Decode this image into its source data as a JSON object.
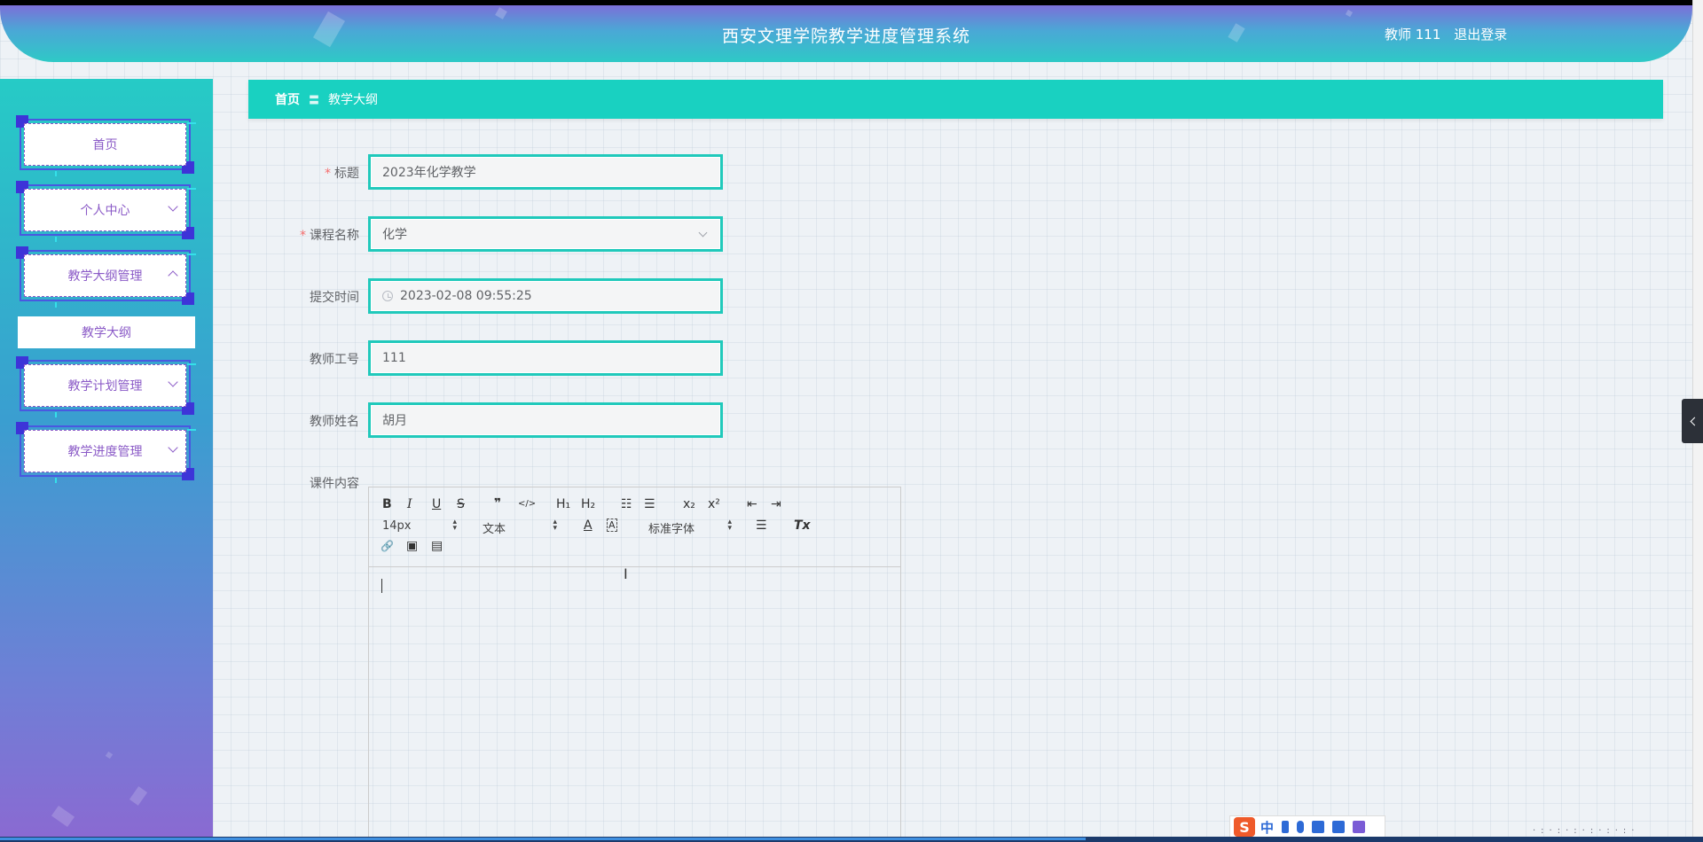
{
  "header": {
    "system_title": "西安文理学院教学进度管理系统",
    "user_label": "教师 111",
    "logout_label": "退出登录"
  },
  "sidebar": {
    "items": [
      {
        "label": "首页"
      },
      {
        "label": "个人中心"
      },
      {
        "label": "教学大纲管理"
      },
      {
        "label": "教学计划管理"
      },
      {
        "label": "教学进度管理"
      }
    ],
    "active_sub_item": "教学大纲"
  },
  "breadcrumb": {
    "home": "首页",
    "separator": "〓",
    "current": "教学大纲"
  },
  "form": {
    "title": {
      "label": "标题",
      "required": true,
      "value": "2023年化学教学"
    },
    "course": {
      "label": "课程名称",
      "required": true,
      "value": "化学"
    },
    "submit_time": {
      "label": "提交时间",
      "value": "2023-02-08 09:55:25"
    },
    "teacher_id": {
      "label": "教师工号",
      "value": "111"
    },
    "teacher_name": {
      "label": "教师姓名",
      "value": "胡月"
    },
    "content": {
      "label": "课件内容"
    }
  },
  "editor": {
    "font_size": "14px",
    "text_type": "文本",
    "font_family": "标准字体",
    "buttons": {
      "bold": "B",
      "italic": "I",
      "underline": "U",
      "strike": "S",
      "quote": "❞",
      "code": "</>",
      "h1": "H₁",
      "h2": "H₂",
      "ordered_list": "☷",
      "bullet_list": "☰",
      "subscript": "x₂",
      "superscript": "x²",
      "indent_decrease": "⇤",
      "indent_increase": "⇥",
      "font_color": "A",
      "bg_color": "A",
      "align": "☰",
      "clean": "Tx",
      "link": "🔗",
      "image": "▣",
      "video": "▤"
    }
  },
  "ime": {
    "logo": "S",
    "mode": "中"
  },
  "colors": {
    "accent": "#19d1c1",
    "sidebar_text": "#8b5bc7",
    "required": "#f56c6c"
  }
}
